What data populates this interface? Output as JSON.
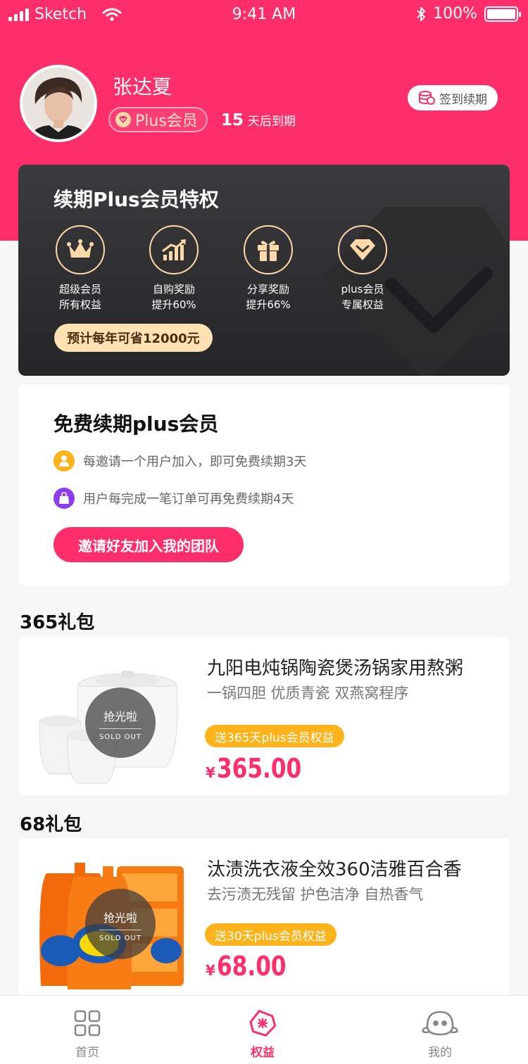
{
  "status_bar": {
    "carrier": "Sketch",
    "time": "9:41 AM",
    "battery": "100%"
  },
  "profile": {
    "name": "张达夏",
    "member_badge": "Plus会员",
    "days_left": "15",
    "expire_suffix": "天后到期",
    "checkin_label": "签到续期"
  },
  "privilege": {
    "title": "续期Plus会员特权",
    "items": [
      {
        "icon": "crown-icon",
        "line1": "超级会员",
        "line2": "所有权益"
      },
      {
        "icon": "chart-up-icon",
        "line1": "自购奖励",
        "line2": "提升60%"
      },
      {
        "icon": "gift-icon",
        "line1": "分享奖励",
        "line2": "提升66%"
      },
      {
        "icon": "diamond-icon",
        "line1": "plus会员",
        "line2": "专属权益"
      }
    ],
    "savings": "预计每年可省12000元"
  },
  "free_renew": {
    "title": "免费续期plus会员",
    "rules": [
      {
        "icon": "user-icon",
        "color": "#ffb31a",
        "text": "每邀请一个用户加入，即可免费续期3天"
      },
      {
        "icon": "bag-icon",
        "color": "#8b3cf0",
        "text": "用户每完成一笔订单可再免费续期4天"
      }
    ],
    "invite_button": "邀请好友加入我的团队"
  },
  "gift_sections": [
    {
      "title": "365礼包",
      "product": {
        "name": "九阳电炖锅陶瓷煲汤锅家用熬粥",
        "desc": "一锅四胆 优质青瓷 双燕窝程序",
        "tag": "送365天plus会员权益",
        "currency": "¥",
        "price": "365.00",
        "sold_out": "抢光啦",
        "sold_out_en": "SOLD OUT"
      }
    },
    {
      "title": "68礼包",
      "product": {
        "name": "汰渍洗衣液全效360洁雅百合香",
        "desc": "去污渍无残留 护色洁净 自热香气",
        "tag": "送30天plus会员权益",
        "currency": "¥",
        "price": "68.00",
        "sold_out": "抢光啦",
        "sold_out_en": "SOLD OUT"
      }
    }
  ],
  "tab_bar": {
    "tabs": [
      {
        "label": "首页",
        "icon": "grid-icon"
      },
      {
        "label": "权益",
        "icon": "coupon-icon"
      },
      {
        "label": "我的",
        "icon": "profile-face-icon"
      }
    ],
    "active": "权益"
  },
  "colors": {
    "brand": "#fe2e6a",
    "gold": "#ffd9a8",
    "tag": "#ffb31a"
  }
}
